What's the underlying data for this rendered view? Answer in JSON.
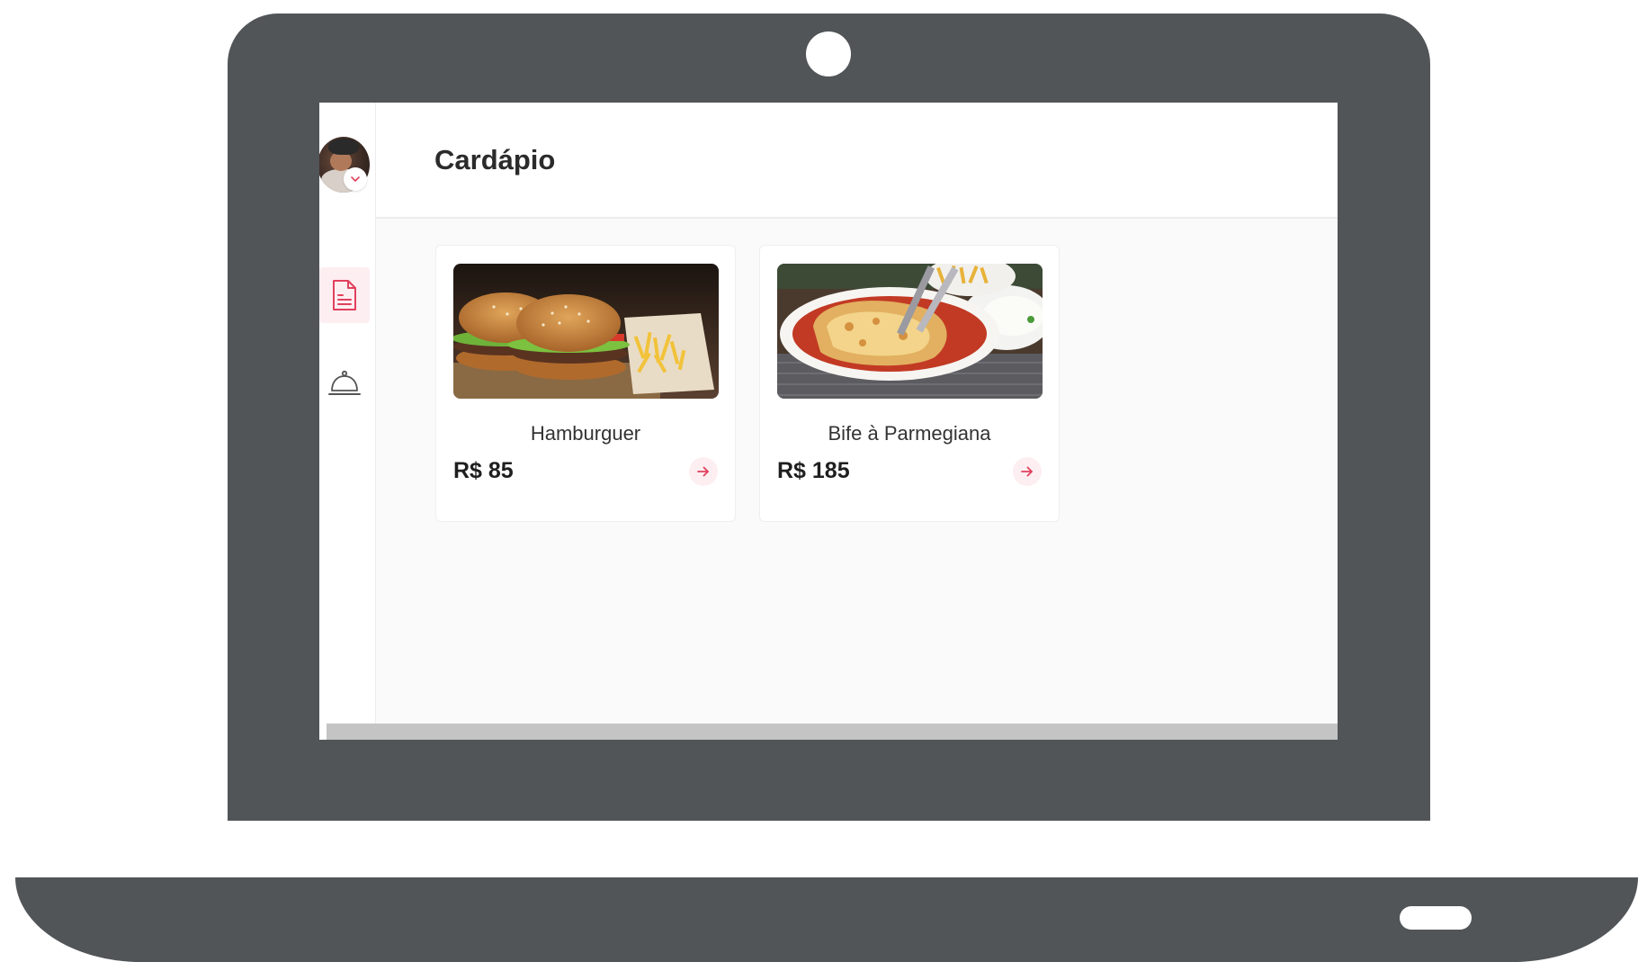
{
  "app": {
    "page_title": "Cardápio",
    "accent_color": "#e1405e"
  },
  "sidebar": {
    "avatar": "avatar",
    "items": [
      {
        "id": "menu",
        "icon": "document-icon",
        "active": true
      },
      {
        "id": "orders",
        "icon": "cloche-icon",
        "active": false
      }
    ]
  },
  "products": [
    {
      "name": "Hamburguer",
      "price": "R$ 85",
      "image": "hamburger-photo"
    },
    {
      "name": "Bife à Parmegiana",
      "price": "R$ 185",
      "image": "parmigiana-photo"
    }
  ]
}
